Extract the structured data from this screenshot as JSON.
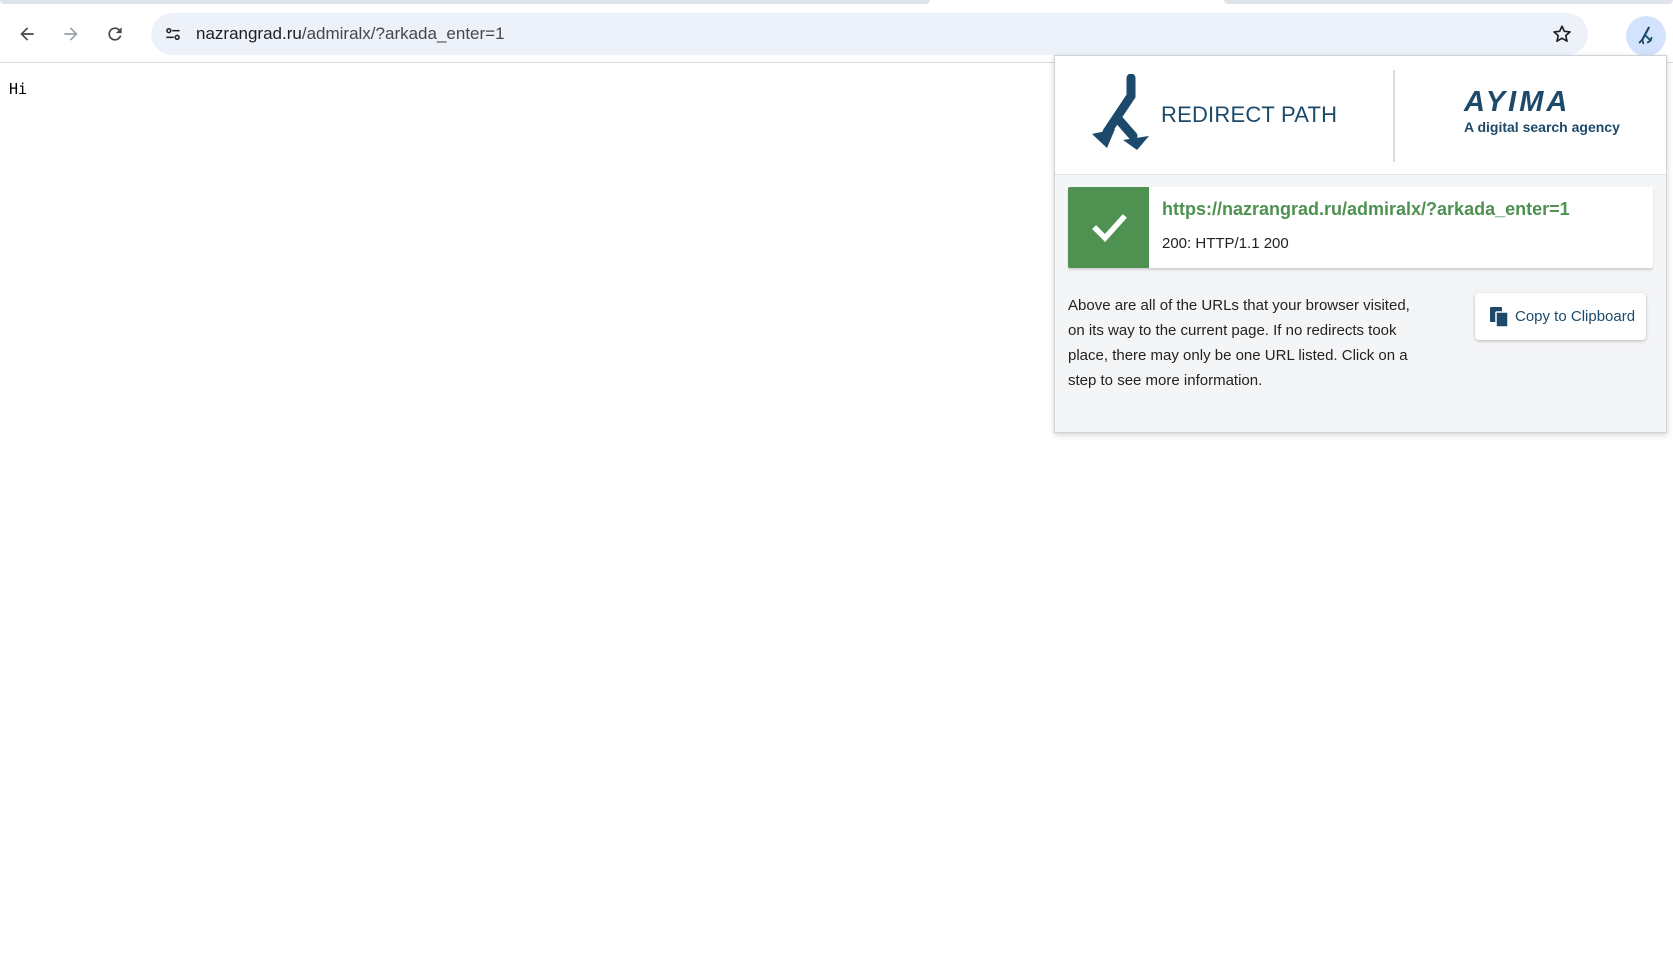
{
  "browser": {
    "url_host": "nazrangrad.ru",
    "url_path": "/admiralx/?arkada_enter=1",
    "icons": {
      "back": "back-arrow-icon",
      "forward": "forward-arrow-icon",
      "reload": "reload-icon",
      "site_info": "tune-icon",
      "bookmark": "star-icon",
      "extension": "redirect-path-icon"
    }
  },
  "page": {
    "body_text": "Hi"
  },
  "popup": {
    "logo_title": "REDIRECT PATH",
    "brand_name": "AYIMA",
    "brand_tagline": "A digital search agency",
    "steps": [
      {
        "url": "https://nazrangrad.ru/admiralx/?arkada_enter=1",
        "status": "200: HTTP/1.1 200",
        "icon": "checkmark-icon"
      }
    ],
    "info_text": "Above are all of the URLs that your browser visited, on its way to the current page. If no redirects took place, there may only be one URL listed. Click on a step to see more information.",
    "copy_button_label": "Copy to Clipboard"
  },
  "colors": {
    "status_ok": "#4e9150",
    "brand_navy": "#1d4a6b",
    "omnibox_bg": "#edf2fa",
    "extension_active_bg": "#d3e3fd"
  }
}
